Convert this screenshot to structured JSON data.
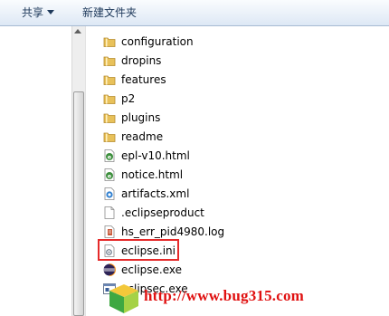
{
  "toolbar": {
    "share_label": "共享",
    "new_folder_label": "新建文件夹"
  },
  "files": [
    {
      "name": "configuration",
      "icon": "folder-icon"
    },
    {
      "name": "dropins",
      "icon": "folder-icon"
    },
    {
      "name": "features",
      "icon": "folder-icon"
    },
    {
      "name": "p2",
      "icon": "folder-icon"
    },
    {
      "name": "plugins",
      "icon": "folder-icon"
    },
    {
      "name": "readme",
      "icon": "folder-icon"
    },
    {
      "name": "epl-v10.html",
      "icon": "html-file-icon"
    },
    {
      "name": "notice.html",
      "icon": "html-file-icon"
    },
    {
      "name": "artifacts.xml",
      "icon": "xml-file-icon"
    },
    {
      "name": ".eclipseproduct",
      "icon": "blank-file-icon"
    },
    {
      "name": "hs_err_pid4980.log",
      "icon": "log-file-icon"
    },
    {
      "name": "eclipse.ini",
      "icon": "ini-file-icon",
      "highlighted": true
    },
    {
      "name": "eclipse.exe",
      "icon": "eclipse-exe-icon"
    },
    {
      "name": "eclipsec.exe",
      "icon": "console-exe-icon"
    }
  ],
  "watermark": {
    "text": "http://www.bug315.com"
  },
  "colors": {
    "highlight_border": "#e52a2a",
    "watermark": "#e01010",
    "toolbar_text": "#1e395b",
    "folder": "#e8c15a"
  }
}
